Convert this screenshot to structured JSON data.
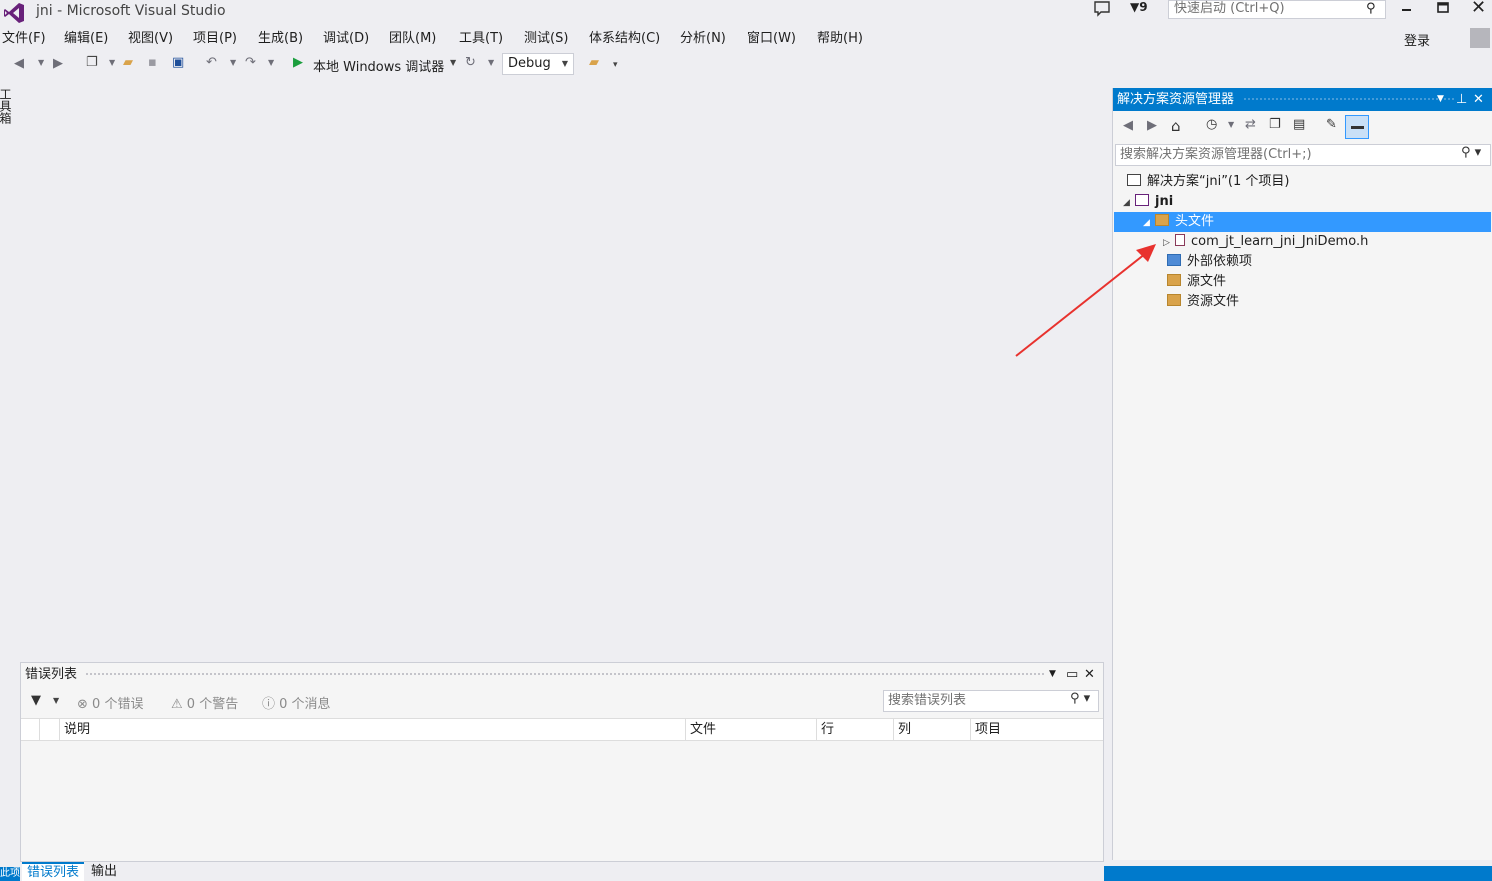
{
  "window": {
    "title": "jni - Microsoft Visual Studio",
    "feedback_count": "9",
    "quick_launch_placeholder": "快速启动 (Ctrl+Q)",
    "login_label": "登录",
    "close_glyph": "✕"
  },
  "menu": [
    "文件(F)",
    "编辑(E)",
    "视图(V)",
    "项目(P)",
    "生成(B)",
    "调试(D)",
    "团队(M)",
    "工具(T)",
    "测试(S)",
    "体系结构(C)",
    "分析(N)",
    "窗口(W)",
    "帮助(H)"
  ],
  "toolbar": {
    "run_label": "本地 Windows 调试器",
    "config_value": "Debug"
  },
  "toolbox_tab": "工具箱",
  "solution_explorer": {
    "title": "解决方案资源管理器",
    "search_placeholder": "搜索解决方案资源管理器(Ctrl+;)",
    "tree": {
      "solution": "解决方案“jni”(1 个项目)",
      "project": "jni",
      "headers": "头文件",
      "header_file": "com_jt_learn_jni_JniDemo.h",
      "external_deps": "外部依赖项",
      "sources": "源文件",
      "resources": "资源文件"
    }
  },
  "error_list": {
    "title": "错误列表",
    "errors": "0 个错误",
    "warnings": "0 个警告",
    "messages": "0 个消息",
    "search_placeholder": "搜索错误列表",
    "columns": [
      "说明",
      "文件",
      "行",
      "列",
      "项目"
    ]
  },
  "bottom_tabs": [
    "错误列表",
    "输出"
  ],
  "status_left": "此项",
  "colors": {
    "accent": "#007acc",
    "selection": "#3399ff",
    "annotation_arrow": "#e8322e"
  }
}
